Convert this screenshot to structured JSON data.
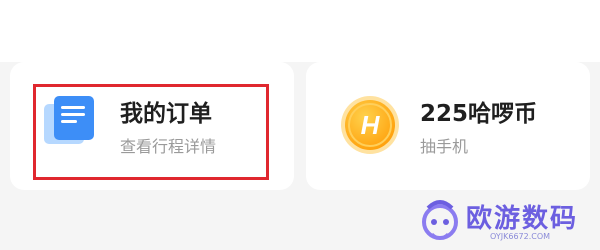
{
  "cards": [
    {
      "title": "我的订单",
      "subtitle": "查看行程详情",
      "icon": "document-icon",
      "highlighted": true
    },
    {
      "title": "225哈啰币",
      "subtitle": "抽手机",
      "icon": "coin-icon",
      "coin_letter": "H"
    }
  ],
  "watermark": {
    "text": "欧游数码",
    "url": "OYJK6672.COM"
  },
  "colors": {
    "highlight": "#e0272f",
    "order_icon_blue": "#3d8ef7",
    "coin_orange": "#ffb21a",
    "watermark": "#6c5fe0"
  }
}
